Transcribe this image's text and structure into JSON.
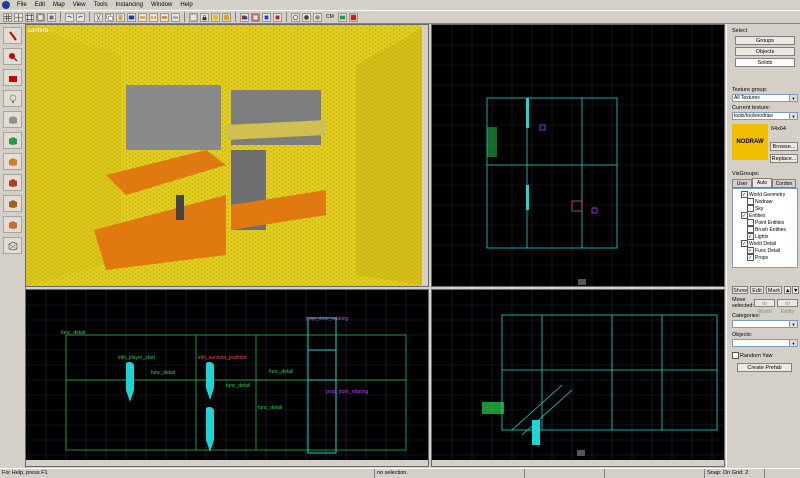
{
  "menu": [
    "File",
    "Edit",
    "Map",
    "View",
    "Tools",
    "Instancing",
    "Window",
    "Help"
  ],
  "toolbar": {
    "cm_label": "CM"
  },
  "viewport_3d": {
    "label": "camera"
  },
  "viewport_side": {
    "entity_labels": [
      {
        "text": "func_detail",
        "color": "#2ad14a"
      },
      {
        "text": "info_player_start",
        "color": "#2ad14a"
      },
      {
        "text": "func_detail",
        "color": "#2ad14a"
      },
      {
        "text": "info_survivor_position",
        "color": "#ff4a4a"
      },
      {
        "text": "func_detail",
        "color": "#2ad14a"
      },
      {
        "text": "prop_door_rotating",
        "color": "#c040ff"
      },
      {
        "text": "prop_door_rotating",
        "color": "#c040ff"
      },
      {
        "text": "func_detail",
        "color": "#2ad14a"
      },
      {
        "text": "func_detail",
        "color": "#2ad14a"
      }
    ]
  },
  "panel": {
    "select_label": "Select",
    "groups_btn": "Groups",
    "objects_btn": "Objects",
    "solids_btn": "Solids",
    "texture_group_label": "Texture group:",
    "texture_group_value": "All Textures",
    "current_texture_label": "Current texture:",
    "current_texture_value": "tools/toolsnodraw",
    "texture_size": "64x64",
    "texture_swatch_text": "NODRAW",
    "browse_btn": "Browse...",
    "replace_btn": "Replace...",
    "visgroups_label": "VisGroups:",
    "tabs": [
      "User",
      "Auto",
      "Cordon"
    ],
    "tree": [
      {
        "text": "World Geometry",
        "indent": 1,
        "checked": true
      },
      {
        "text": "Nodraw",
        "indent": 2,
        "checked": false
      },
      {
        "text": "Sky",
        "indent": 2,
        "checked": false
      },
      {
        "text": "Entities",
        "indent": 1,
        "checked": true
      },
      {
        "text": "Point Entities",
        "indent": 2,
        "checked": false
      },
      {
        "text": "Brush Entities",
        "indent": 2,
        "checked": false
      },
      {
        "text": "Lights",
        "indent": 2,
        "checked": true
      },
      {
        "text": "World Detail",
        "indent": 1,
        "checked": true
      },
      {
        "text": "Func Detail",
        "indent": 2,
        "checked": true
      },
      {
        "text": "Props",
        "indent": 2,
        "checked": true
      }
    ],
    "show_btn": "Show",
    "edit_btn": "Edit",
    "mark_btn": "Mark",
    "move_selected_label": "Move selected:",
    "to_world_btn": "to World",
    "to_entity_btn": "to Entity",
    "categories_label": "Categories:",
    "objects_label": "Objects:",
    "random_yaw_label": "Random Yaw",
    "create_prefab_btn": "Create Prefab"
  },
  "status": {
    "help": "For Help, press F1",
    "selection": "no selection.",
    "snap": "Snap: On Grid: 2"
  },
  "colors": {
    "grid_bg": "#000000",
    "brush": "#1fd4d4",
    "wall_yellow": "#e8d020",
    "floor_orange": "#e07a10"
  }
}
